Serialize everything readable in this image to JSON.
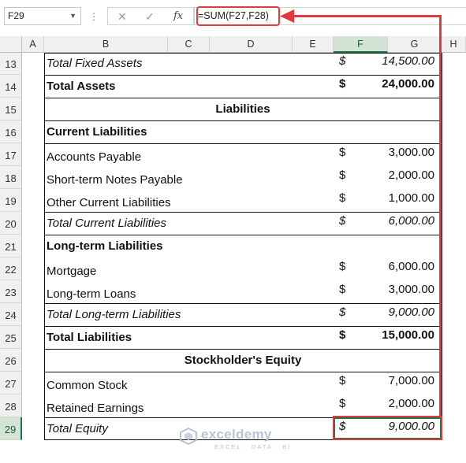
{
  "formula_bar": {
    "name_box": "F29",
    "cancel_icon": "✕",
    "enter_icon": "✓",
    "fx_label": "fx",
    "formula": "=SUM(F27,F28)"
  },
  "columns": [
    "A",
    "B",
    "C",
    "D",
    "E",
    "F",
    "G",
    "H"
  ],
  "selected_column": "F",
  "selected_row": "29",
  "rows": [
    {
      "num": "13",
      "label": "Total Fixed Assets",
      "currency": "$",
      "amount": "14,500.00"
    },
    {
      "num": "14",
      "label": "Total Assets",
      "currency": "$",
      "amount": "24,000.00"
    },
    {
      "num": "15",
      "label": "Liabilities"
    },
    {
      "num": "16",
      "label": "Current Liabilities"
    },
    {
      "num": "17",
      "label": "Accounts Payable",
      "currency": "$",
      "amount": "3,000.00"
    },
    {
      "num": "18",
      "label": "Short-term Notes Payable",
      "currency": "$",
      "amount": "2,000.00"
    },
    {
      "num": "19",
      "label": "Other Current Liabilities",
      "currency": "$",
      "amount": "1,000.00"
    },
    {
      "num": "20",
      "label": "Total Current Liabilities",
      "currency": "$",
      "amount": "6,000.00"
    },
    {
      "num": "21",
      "label": "Long-term Liabilities"
    },
    {
      "num": "22",
      "label": "Mortgage",
      "currency": "$",
      "amount": "6,000.00"
    },
    {
      "num": "23",
      "label": "Long-term Loans",
      "currency": "$",
      "amount": "3,000.00"
    },
    {
      "num": "24",
      "label": "Total Long-term Liabilities",
      "currency": "$",
      "amount": "9,000.00"
    },
    {
      "num": "25",
      "label": "Total Liabilities",
      "currency": "$",
      "amount": "15,000.00"
    },
    {
      "num": "26",
      "label": "Stockholder's Equity"
    },
    {
      "num": "27",
      "label": "Common Stock",
      "currency": "$",
      "amount": "7,000.00"
    },
    {
      "num": "28",
      "label": "Retained Earnings",
      "currency": "$",
      "amount": "2,000.00"
    },
    {
      "num": "29",
      "label": "Total Equity",
      "currency": "$",
      "amount": "9,000.00"
    }
  ],
  "watermark": {
    "name": "exceldemy",
    "tagline": "EXCEL · DATA · BI"
  },
  "colors": {
    "accent_green": "#217346",
    "callout_red": "#e0393e"
  }
}
